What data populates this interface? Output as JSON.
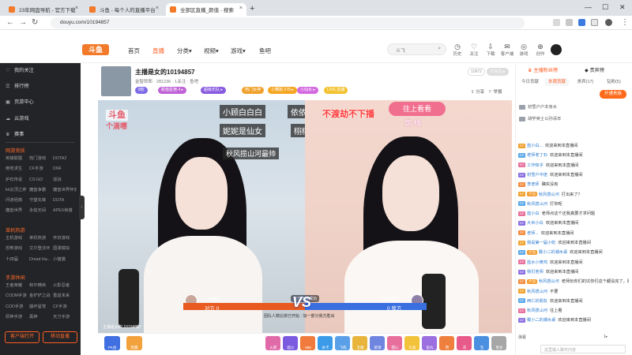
{
  "browser": {
    "tabs": [
      {
        "label": "23年网盘导航 - 官方下载",
        "active": false
      },
      {
        "label": "斗鱼 - 每个人的直播平台",
        "active": false
      },
      {
        "label": "全部区直播_颜值 - 搜索",
        "active": true
      }
    ],
    "url": "douyu.com/10194857",
    "colors": {
      "favicon": "#f27a2a"
    }
  },
  "site": {
    "logo": "斗鱼",
    "nav": [
      {
        "label": "首页",
        "active": false
      },
      {
        "label": "直播",
        "active": true
      },
      {
        "label": "分类▾",
        "active": false
      },
      {
        "label": "视频▾",
        "active": false
      },
      {
        "label": "游戏▾",
        "active": false
      },
      {
        "label": "鱼吧",
        "active": false
      }
    ],
    "search_placeholder": "斗飞",
    "header_icons": [
      {
        "icon": "history-icon",
        "label": "历史"
      },
      {
        "icon": "follow-icon",
        "label": "关注"
      },
      {
        "icon": "download-icon",
        "label": "下载"
      },
      {
        "icon": "message-icon",
        "label": "客户端"
      },
      {
        "icon": "game-icon",
        "label": "游戏"
      },
      {
        "icon": "creator-icon",
        "label": "创作"
      }
    ],
    "accent": "#ff5d23"
  },
  "sidebar": {
    "items": [
      {
        "icon": "heart-icon",
        "label": "我的关注"
      },
      {
        "icon": "rank-icon",
        "label": "排行榜"
      },
      {
        "icon": "center-icon",
        "label": "页游中心"
      },
      {
        "icon": "cloud-icon",
        "label": "云游戏"
      },
      {
        "icon": "match-icon",
        "label": "赛事"
      }
    ],
    "sections": [
      {
        "title": "网游竞技",
        "items": [
          "英雄联盟",
          "热门游戏",
          "DOTA2",
          "绝地求生",
          "CF手游",
          "DNF",
          "炉石传说",
          "CS:GO",
          "逆战",
          "lol云顶之弈",
          "魔兽争霸",
          "魔兽世界怀旧",
          "问道经典",
          "守望先锋",
          "DOTA",
          "魔兽世界",
          "永劫无间",
          "APEX英雄"
        ]
      },
      {
        "title": "单机热游",
        "items": [
          "主机游戏",
          "单机热游",
          "怀旧游戏",
          "恐怖游戏",
          "艾尔登法环",
          "国漫模拟",
          "十四届",
          "Dread Ha...",
          "小猫猫"
        ]
      },
      {
        "title": "手游休闲",
        "items": [
          "王者荣耀",
          "和平精英",
          "火影忍者",
          "CODM手游",
          "金铲铲之战",
          "重返未来",
          "COD手游",
          "崩坏星穹",
          "CF手游",
          "原神手游",
          "黑神",
          "天刀手游"
        ]
      }
    ],
    "buttons": {
      "client": "客户端打开",
      "mobile": "移动直播"
    }
  },
  "room": {
    "title": "主播是女的10194857",
    "meta": "金智郎郎  ·  281236  ·  1关注  ·  鱼吧",
    "tags": [
      {
        "label": "8粉",
        "color": "#7e6be8"
      },
      {
        "label": "颜值星宿 4 ▸",
        "color": "#c063d6"
      },
      {
        "label": "超级乐队 ▸",
        "color": "#8a5de0"
      },
      {
        "label": "热门女神",
        "color": "#f0a12c"
      },
      {
        "label": "小舞蹈 278 ▸",
        "color": "#f5a623"
      },
      {
        "label": "小仙女 ▸",
        "color": "#d36ae0"
      },
      {
        "label": "LIVE 直播",
        "color": "#f2c230"
      }
    ],
    "follow_count": "10972",
    "follow_label": "已关注 ▸",
    "share_label": "分享",
    "report_label": "举报",
    "video": {
      "left_overlay_lines": [
        "小顾白白白",
        "妮妮是仙女",
        "秋风揽山河最帅"
      ],
      "left_side_labels": [
        "依依",
        "栩栩"
      ],
      "right_overlay": "不渡劫不下播",
      "on_stage_button": "往上看看",
      "on_stage_sub": "氛·线",
      "left_brand_sub": "个滴嘤",
      "vs_text": "VS",
      "score_left": "对方 0",
      "score_right": "0 我方",
      "player_left": "林思萌",
      "player_right": "宝贝宝宝",
      "vs_message": "团队人数比拼已开始  ·  加一部分我方胜出",
      "timer": "双方连接成功",
      "room_number_overlay": "主播是女的 10194857",
      "rec_label": "REC"
    },
    "gifts": [
      {
        "label": "PK战",
        "color": "#3f6fe0"
      },
      {
        "label": "稳赢",
        "color": "#f2a13c"
      },
      {
        "label": "火箭",
        "color": "#e06aa8"
      },
      {
        "label": "超火",
        "color": "#7a5be0"
      },
      {
        "label": "666",
        "color": "#f07b3c"
      },
      {
        "label": "办卡",
        "color": "#3b9be8"
      },
      {
        "label": "飞机",
        "color": "#5aa0e8"
      },
      {
        "label": "宝箱",
        "color": "#e8b43b"
      },
      {
        "label": "星球",
        "color": "#6f86e0"
      },
      {
        "label": "甜心",
        "color": "#e86f9c"
      },
      {
        "label": "礼盒",
        "color": "#f3c23b"
      },
      {
        "label": "鱼丸",
        "color": "#9b6fe0"
      },
      {
        "label": "赞",
        "color": "#ef7f3c"
      },
      {
        "label": "花",
        "color": "#e85a8a"
      },
      {
        "label": "宝",
        "color": "#4a8fe0"
      },
      {
        "label": "更多",
        "color": "#a6a6a6"
      }
    ]
  },
  "chatpanel": {
    "tabs": [
      "主播粉丝榜",
      "贵宾榜"
    ],
    "subtabs": [
      "今日贡献",
      "本周贡献",
      "贵宾(17)",
      "钻粉(5)"
    ],
    "vip_button": "开通贵族",
    "ranks": [
      "初雪户户本身水",
      "胡学英士公孙清年"
    ],
    "messages": [
      {
        "lv": "LV",
        "name": "蓝小白...",
        "text": "欢迎来到本直播间",
        "badge": ""
      },
      {
        "lv": "LV",
        "name": "老师老丁石",
        "text": "欢迎来到本直播间",
        "badge": ""
      },
      {
        "lv": "LV",
        "name": "工作知乎",
        "text": "欢迎来到本直播间",
        "badge": ""
      },
      {
        "lv": "LV",
        "name": "初雪户中途",
        "text": "欢迎来到本直播间",
        "badge": ""
      },
      {
        "lv": "LV",
        "name": "李老师",
        "text": "确实没有",
        "badge": ""
      },
      {
        "lv": "LV",
        "name": "秋风揽山河",
        "text": "打出来了？",
        "badge": "大仙"
      },
      {
        "lv": "LV",
        "name": "秋风揽山河",
        "text": "打你呢",
        "badge": ""
      },
      {
        "lv": "LV",
        "name": "蓝小白",
        "text": "老师点这个还我真要才求问题",
        "badge": ""
      },
      {
        "lv": "LV",
        "name": "大米小白",
        "text": "欢迎来到本直播间",
        "badge": ""
      },
      {
        "lv": "LV",
        "name": "老师...",
        "text": "欢迎来到本直播间",
        "badge": ""
      },
      {
        "lv": "LV",
        "name": "我是第一届小奶",
        "text": "欢迎来到本直播间",
        "badge": ""
      },
      {
        "lv": "LV",
        "name": "戴小二的潮水桌",
        "text": "欢迎来到本直播间",
        "badge": "大仙"
      },
      {
        "lv": "LV",
        "name": "蓝水小黄鸡",
        "text": "欢迎来到本直播间",
        "badge": ""
      },
      {
        "lv": "LV",
        "name": "我们老师",
        "text": "欢迎来到本直播间",
        "badge": ""
      },
      {
        "lv": "LV",
        "name": "秋风揽山河",
        "text": "老师玩你们的坑你们这个都没完了，原先倒的",
        "badge": "大仙"
      },
      {
        "lv": "LV",
        "name": "秋风揽山河",
        "text": "不要",
        "badge": ""
      },
      {
        "lv": "LV",
        "name": "两仁的朋友",
        "text": "欢迎来到本直播间",
        "badge": ""
      },
      {
        "lv": "LV",
        "name": "秋风揽山河",
        "text": "往上看",
        "badge": ""
      },
      {
        "lv": "LV",
        "name": "戴小二的潮水桌",
        "text": "欢迎来到本直播间",
        "badge": ""
      }
    ],
    "bottom_left": "弹幕",
    "bottom_right": "1▸",
    "input_placeholder": "这里输入聊天内容"
  }
}
